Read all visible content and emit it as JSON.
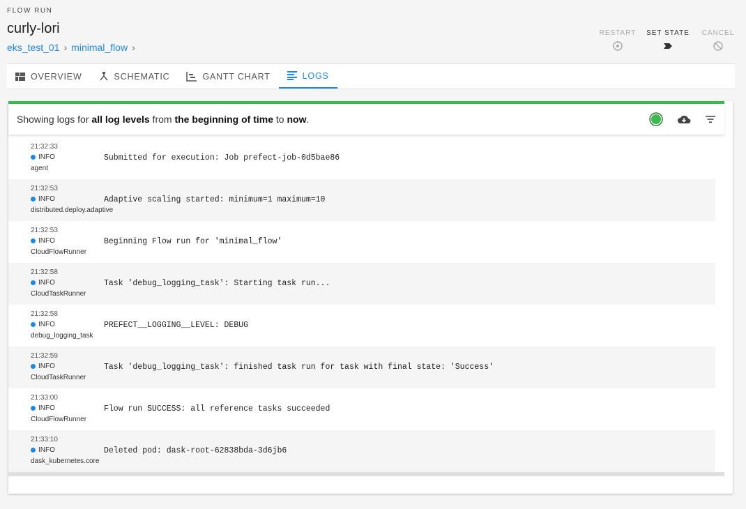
{
  "header": {
    "eyebrow": "FLOW RUN",
    "title": "curly-lori",
    "breadcrumbs": [
      "eks_test_01",
      "minimal_flow"
    ],
    "sep": "›"
  },
  "actions": [
    {
      "label": "RESTART",
      "icon": "restart-icon",
      "enabled": false
    },
    {
      "label": "SET STATE",
      "icon": "set-state-icon",
      "enabled": true
    },
    {
      "label": "CANCEL",
      "icon": "cancel-icon",
      "enabled": false
    }
  ],
  "tabs": [
    {
      "label": "OVERVIEW",
      "icon": "overview-icon",
      "active": false
    },
    {
      "label": "SCHEMATIC",
      "icon": "schematic-icon",
      "active": false
    },
    {
      "label": "GANTT CHART",
      "icon": "gantt-chart-icon",
      "active": false
    },
    {
      "label": "LOGS",
      "icon": "logs-icon",
      "active": true
    }
  ],
  "summary": {
    "prefix": "Showing logs for ",
    "levels": "all log levels",
    "mid1": " from ",
    "from": "the beginning of time",
    "mid2": " to ",
    "to": "now",
    "suffix": "."
  },
  "colors": {
    "accent": "#1e88e5",
    "status_green": "#3cb94f",
    "info_dot": "#1e88e5"
  },
  "logs": [
    {
      "time": "21:32:33",
      "level": "INFO",
      "source": "agent",
      "message": "Submitted for execution: Job prefect-job-0d5bae86"
    },
    {
      "time": "21:32:53",
      "level": "INFO",
      "source": "distributed.deploy.adaptive",
      "message": "Adaptive scaling started: minimum=1 maximum=10"
    },
    {
      "time": "21:32:53",
      "level": "INFO",
      "source": "CloudFlowRunner",
      "message": "Beginning Flow run for 'minimal_flow'"
    },
    {
      "time": "21:32:58",
      "level": "INFO",
      "source": "CloudTaskRunner",
      "message": "Task 'debug_logging_task': Starting task run..."
    },
    {
      "time": "21:32:58",
      "level": "INFO",
      "source": "debug_logging_task",
      "message": "PREFECT__LOGGING__LEVEL: DEBUG"
    },
    {
      "time": "21:32:59",
      "level": "INFO",
      "source": "CloudTaskRunner",
      "message": "Task 'debug_logging_task': finished task run for task with final state: 'Success'"
    },
    {
      "time": "21:33:00",
      "level": "INFO",
      "source": "CloudFlowRunner",
      "message": "Flow run SUCCESS: all reference tasks succeeded"
    },
    {
      "time": "21:33:10",
      "level": "INFO",
      "source": "dask_kubernetes.core",
      "message": "Deleted pod: dask-root-62838bda-3d6jb6"
    }
  ]
}
